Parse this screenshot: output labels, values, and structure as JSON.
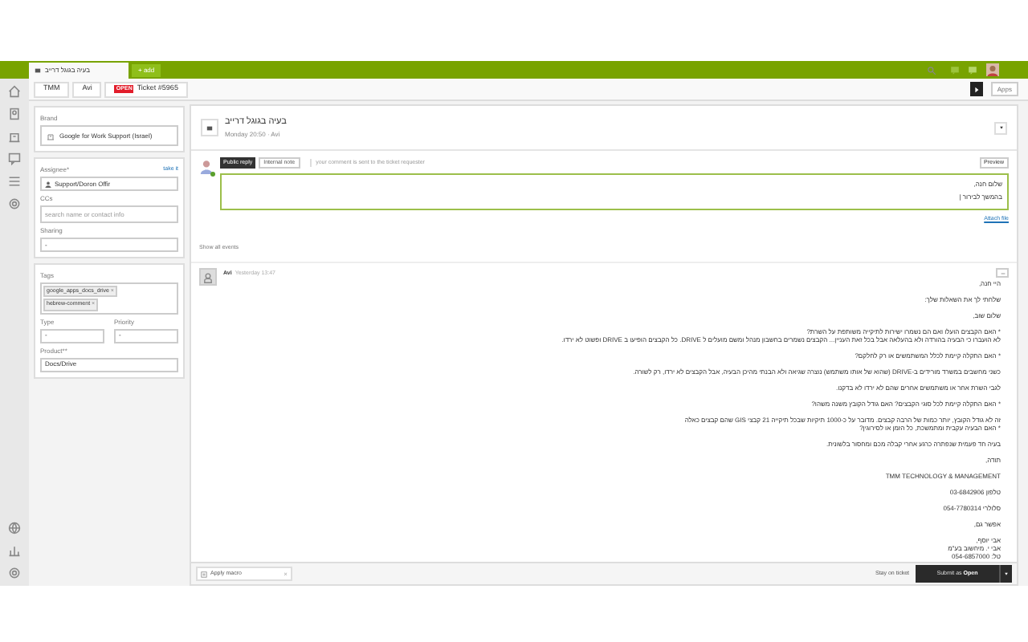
{
  "top_bar": {
    "tabs": [
      {
        "label": "בעיה בגוגל דרייב",
        "selected": true
      }
    ],
    "add_button": "+ add"
  },
  "breadcrumbs": {
    "organization": "TMM",
    "requester": "Avi",
    "ticket": {
      "label": "Ticket #5965",
      "badge": "OPEN"
    }
  },
  "apps_button": "Apps",
  "property_cards": [
    {
      "fields": [
        {
          "kind": "brand",
          "label": "Brand",
          "value": "Google for Work Support (Israel)"
        }
      ]
    },
    {
      "fields": [
        {
          "kind": "assignee",
          "label": "Assignee*",
          "link": "take it",
          "value": "Support/Doron Offir"
        },
        {
          "kind": "input",
          "label": "CCs",
          "placeholder": "search name or contact info"
        },
        {
          "kind": "select",
          "label": "Sharing",
          "value": "-"
        }
      ]
    },
    {
      "fields": [
        {
          "kind": "tags",
          "label": "Tags",
          "tags": [
            {
              "label": "google_apps_docs_drive",
              "remove": "×"
            },
            {
              "label": "hebrew-comment",
              "remove": "×"
            }
          ]
        },
        {
          "kind": "pair",
          "type": {
            "label": "Type",
            "value": "-"
          },
          "priority": {
            "label": "Priority",
            "value": "-"
          }
        },
        {
          "kind": "select",
          "label": "Product**",
          "value": "Docs/Drive"
        }
      ]
    }
  ],
  "ticket": {
    "title": "בעיה בגוגל דרייב",
    "meta": "Monday 20:50  ·  Avi"
  },
  "reply": {
    "public_reply": {
      "label": "Public reply",
      "selected": true
    },
    "internal_note": {
      "label": "Internal note",
      "selected": false
    },
    "hint": "your comment is sent to the ticket requester",
    "preview": "Preview",
    "lines": [
      "שלום חנה,",
      "בהמשך לבירור |"
    ],
    "attach": "Attach file"
  },
  "show_all_events": "Show all events",
  "comment": {
    "author": "Avi",
    "time": "Yesterday 13:47",
    "paragraphs": [
      [
        "היי חנה,"
      ],
      [
        "שלחתי לך את השאלות שלך:"
      ],
      [
        "שלום שוב,"
      ],
      [
        "* האם הקבצים הועלו ואם הם נשמרו ישירות לתיקייה משותפת על השרת?",
        "לא הועברו כי הבעיה בהורדה ולא בהעלאה אבל בכל זאת העניין... הקבצים נשמרים בחשבון מנהל ומשם מועלים ל DRIVE. כל הקבצים הופיעו ב DRIVE ופשוט לא ירדו."
      ],
      [
        "* האם התקלה קיימת לכלל המשתמשים או רק לחלקם?"
      ],
      [
        "כשני מחשבים במשרד מורידים ב-DRIVE (שהוא של אותו משתמש) נוצרה שגיאה ולא הבנתי מהיכן הבעיה, אבל הקבצים לא ירדו, רק לשורה."
      ],
      [
        "לגבי השרת אחר או משתמשים אחרים שהם לא ירדו לא בדקנו."
      ],
      [
        "* האם התקלה קיימת לכל סוגי הקבצים? האם גודל הקובץ משנה משהו?"
      ],
      [
        "זה לא גודל הקובץ, יותר כמות של הרבה קבצים. מדובר על כ-1000 תיקיות שבכל תיקייה 21 קבצי GIS שהם קבצים כאלה",
        "* האם הבעיה עקבית ומתמשכת, כל הזמן או לסירוגין?"
      ],
      [
        "בעיה חד פעמית שנפתרה כרגע אחרי קבלה מכם ומחסור בלשונית."
      ],
      [
        "תודה,"
      ],
      [
        "TMM TECHNOLOGY & MANAGEMENT"
      ],
      [
        "טלפון 03-6842906"
      ],
      [
        "סלולרי 054-7780314"
      ],
      [
        "אפשר גם,"
      ],
      [
        "אבי יוסף,",
        "אבי י. מיחשוב בע\"מ",
        "טל: 054-6857000"
      ]
    ]
  },
  "footer": {
    "macro_placeholder": "Apply macro",
    "macro_clear": "×",
    "stay": "Stay on ticket",
    "submit": "Submit as",
    "submit_status": "Open"
  }
}
